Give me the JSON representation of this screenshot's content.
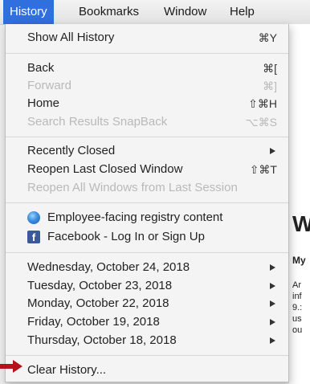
{
  "menubar": {
    "items": [
      {
        "label": "History",
        "active": true
      },
      {
        "label": "Bookmarks"
      },
      {
        "label": "Window"
      },
      {
        "label": "Help"
      }
    ]
  },
  "menu": {
    "show_all_history": {
      "label": "Show All History",
      "shortcut": "⌘Y"
    },
    "back": {
      "label": "Back",
      "shortcut": "⌘["
    },
    "forward": {
      "label": "Forward",
      "shortcut": "⌘]"
    },
    "home": {
      "label": "Home",
      "shortcut": "⇧⌘H"
    },
    "search_snapback": {
      "label": "Search Results SnapBack",
      "shortcut": "⌥⌘S"
    },
    "recently_closed": {
      "label": "Recently Closed"
    },
    "reopen_last_window": {
      "label": "Reopen Last Closed Window",
      "shortcut": "⇧⌘T"
    },
    "reopen_all_windows": {
      "label": "Reopen All Windows from Last Session"
    },
    "history_pages": [
      {
        "label": "Employee-facing registry content",
        "icon": "globe-icon"
      },
      {
        "label": "Facebook - Log In or Sign Up",
        "icon": "facebook-icon"
      }
    ],
    "days": [
      {
        "label": "Wednesday, October 24, 2018"
      },
      {
        "label": "Tuesday, October 23, 2018"
      },
      {
        "label": "Monday, October 22, 2018"
      },
      {
        "label": "Friday, October 19, 2018"
      },
      {
        "label": "Thursday, October 18, 2018"
      }
    ],
    "clear_history": {
      "label": "Clear History..."
    }
  },
  "background_page": {
    "heading": "W",
    "subheading": "My",
    "paragraph_lines": [
      "Ar",
      "inf",
      "9.:",
      "us",
      "ou"
    ]
  },
  "colors": {
    "menu_highlight": "#2f6fde",
    "annotation_arrow": "#b5121b",
    "facebook_blue": "#3b5998"
  }
}
